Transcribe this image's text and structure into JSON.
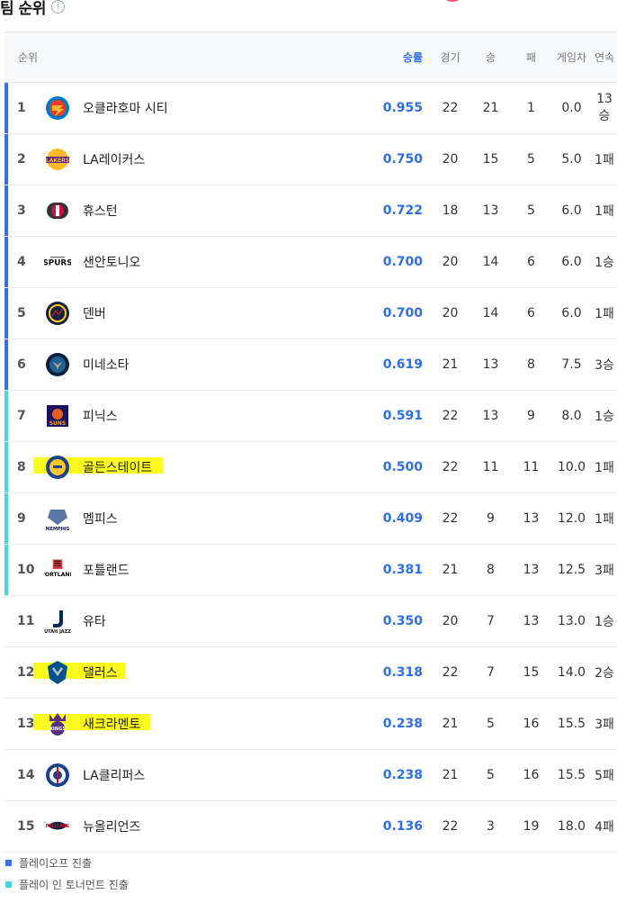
{
  "page_title": "팀 순위",
  "info_icon": "i",
  "columns": {
    "rank": "순위",
    "pct": "승률",
    "games": "경기",
    "wins": "승",
    "losses": "패",
    "gb": "게임차",
    "streak": "연속"
  },
  "teams": [
    {
      "rank": "1",
      "name": "오클라호마 시티",
      "pct": "0.955",
      "games": "22",
      "wins": "21",
      "losses": "1",
      "gb": "0.0",
      "streak": "13승",
      "group": "playoff",
      "logo": "thunder-logo",
      "highlight": false
    },
    {
      "rank": "2",
      "name": "LA레이커스",
      "pct": "0.750",
      "games": "20",
      "wins": "15",
      "losses": "5",
      "gb": "5.0",
      "streak": "1패",
      "group": "playoff",
      "logo": "lakers-logo",
      "highlight": false
    },
    {
      "rank": "3",
      "name": "휴스턴",
      "pct": "0.722",
      "games": "18",
      "wins": "13",
      "losses": "5",
      "gb": "6.0",
      "streak": "1패",
      "group": "playoff",
      "logo": "rockets-logo",
      "highlight": false
    },
    {
      "rank": "4",
      "name": "샌안토니오",
      "pct": "0.700",
      "games": "20",
      "wins": "14",
      "losses": "6",
      "gb": "6.0",
      "streak": "1승",
      "group": "playoff",
      "logo": "spurs-logo",
      "highlight": false
    },
    {
      "rank": "5",
      "name": "덴버",
      "pct": "0.700",
      "games": "20",
      "wins": "14",
      "losses": "6",
      "gb": "6.0",
      "streak": "1패",
      "group": "playoff",
      "logo": "nuggets-logo",
      "highlight": false
    },
    {
      "rank": "6",
      "name": "미네소타",
      "pct": "0.619",
      "games": "21",
      "wins": "13",
      "losses": "8",
      "gb": "7.5",
      "streak": "3승",
      "group": "playoff",
      "logo": "timberwolves-logo",
      "highlight": false
    },
    {
      "rank": "7",
      "name": "피닉스",
      "pct": "0.591",
      "games": "22",
      "wins": "13",
      "losses": "9",
      "gb": "8.0",
      "streak": "1승",
      "group": "playin",
      "logo": "suns-logo",
      "highlight": false
    },
    {
      "rank": "8",
      "name": "골든스테이트",
      "pct": "0.500",
      "games": "22",
      "wins": "11",
      "losses": "11",
      "gb": "10.0",
      "streak": "1패",
      "group": "playin",
      "logo": "warriors-logo",
      "highlight": true
    },
    {
      "rank": "9",
      "name": "멤피스",
      "pct": "0.409",
      "games": "22",
      "wins": "9",
      "losses": "13",
      "gb": "12.0",
      "streak": "1패",
      "group": "playin",
      "logo": "grizzlies-logo",
      "highlight": false
    },
    {
      "rank": "10",
      "name": "포틀랜드",
      "pct": "0.381",
      "games": "21",
      "wins": "8",
      "losses": "13",
      "gb": "12.5",
      "streak": "3패",
      "group": "playin",
      "logo": "blazers-logo",
      "highlight": false
    },
    {
      "rank": "11",
      "name": "유타",
      "pct": "0.350",
      "games": "20",
      "wins": "7",
      "losses": "13",
      "gb": "13.0",
      "streak": "1승",
      "group": "none",
      "logo": "jazz-logo",
      "highlight": false
    },
    {
      "rank": "12",
      "name": "댈러스",
      "pct": "0.318",
      "games": "22",
      "wins": "7",
      "losses": "15",
      "gb": "14.0",
      "streak": "2승",
      "group": "none",
      "logo": "mavericks-logo",
      "highlight": true
    },
    {
      "rank": "13",
      "name": "새크라멘토",
      "pct": "0.238",
      "games": "21",
      "wins": "5",
      "losses": "16",
      "gb": "15.5",
      "streak": "3패",
      "group": "none",
      "logo": "kings-logo",
      "highlight": true
    },
    {
      "rank": "14",
      "name": "LA클리퍼스",
      "pct": "0.238",
      "games": "21",
      "wins": "5",
      "losses": "16",
      "gb": "15.5",
      "streak": "5패",
      "group": "none",
      "logo": "clippers-logo",
      "highlight": false
    },
    {
      "rank": "15",
      "name": "뉴올리언즈",
      "pct": "0.136",
      "games": "22",
      "wins": "3",
      "losses": "19",
      "gb": "18.0",
      "streak": "4패",
      "group": "none",
      "logo": "pelicans-logo",
      "highlight": false
    }
  ],
  "legend": [
    {
      "label": "플레이오프 진출",
      "color": "#3b6fe8"
    },
    {
      "label": "플레이 인 토너먼트 진출",
      "color": "#49d3dc"
    }
  ],
  "colors": {
    "accent": "#2f6fe0",
    "highlight": "#fbfb1c"
  }
}
